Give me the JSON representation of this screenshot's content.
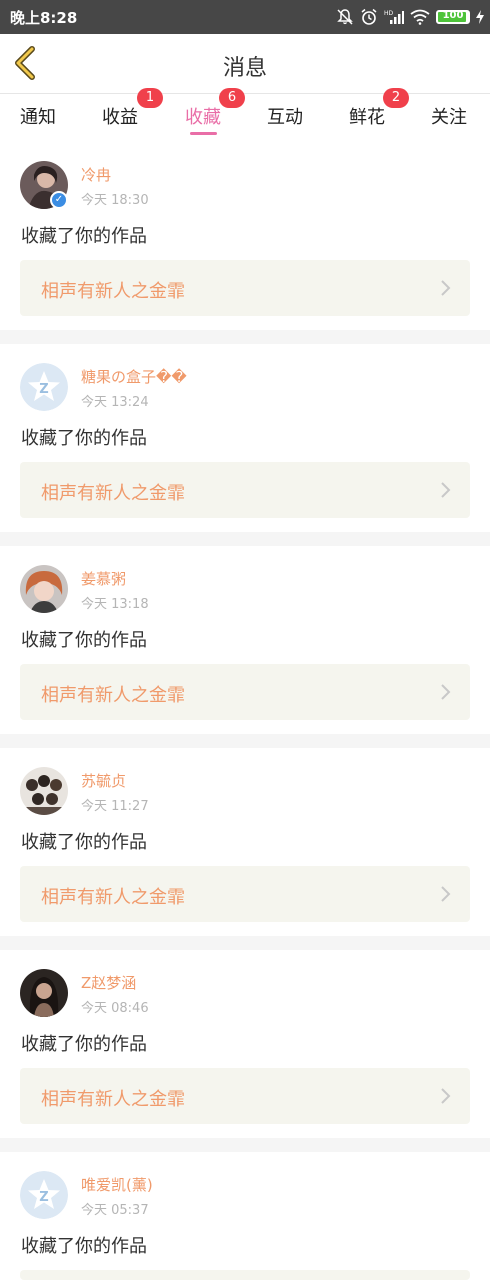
{
  "status_bar": {
    "time": "晚上8:28",
    "battery": "100"
  },
  "header": {
    "title": "消息"
  },
  "tabs": [
    {
      "label": "通知",
      "badge": ""
    },
    {
      "label": "收益",
      "badge": "1"
    },
    {
      "label": "收藏",
      "badge": "6",
      "active": true
    },
    {
      "label": "互动",
      "badge": ""
    },
    {
      "label": "鲜花",
      "badge": "2"
    },
    {
      "label": "关注",
      "badge": ""
    }
  ],
  "messages": [
    {
      "user": "冷冉",
      "time": "今天 18:30",
      "action": "收藏了你的作品",
      "work": "相声有新人之金霏",
      "avatar": "photo",
      "verified": true
    },
    {
      "user": "糖果の盒子��",
      "time": "今天 13:24",
      "action": "收藏了你的作品",
      "work": "相声有新人之金霏",
      "avatar": "default",
      "verified": false
    },
    {
      "user": "姜慕粥",
      "time": "今天 13:18",
      "action": "收藏了你的作品",
      "work": "相声有新人之金霏",
      "avatar": "photo",
      "verified": false
    },
    {
      "user": "苏毓贞",
      "time": "今天 11:27",
      "action": "收藏了你的作品",
      "work": "相声有新人之金霏",
      "avatar": "photo",
      "verified": false
    },
    {
      "user": "Z赵梦涵",
      "time": "今天 08:46",
      "action": "收藏了你的作品",
      "work": "相声有新人之金霏",
      "avatar": "photo",
      "verified": false
    },
    {
      "user": "唯爱凯(薰)",
      "time": "今天 05:37",
      "action": "收藏了你的作品",
      "work": "",
      "avatar": "default",
      "verified": false
    }
  ]
}
